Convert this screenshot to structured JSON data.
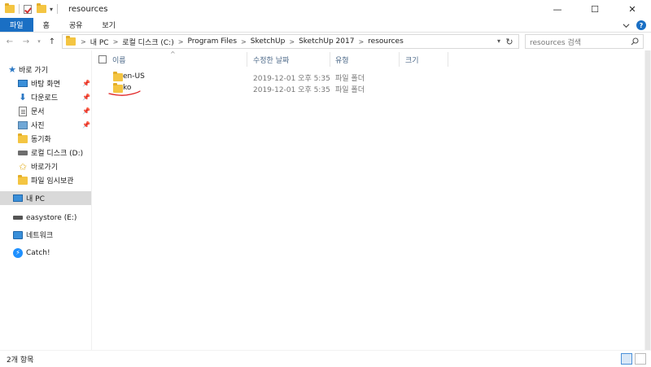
{
  "window": {
    "title": "resources",
    "controls": {
      "minimize": "—",
      "maximize": "☐",
      "close": "✕"
    }
  },
  "ribbon": {
    "tabs": [
      {
        "label": "파일",
        "active": true
      },
      {
        "label": "홈",
        "active": false
      },
      {
        "label": "공유",
        "active": false
      },
      {
        "label": "보기",
        "active": false
      }
    ],
    "accent_color": "#1a6fc4"
  },
  "address_bar": {
    "breadcrumbs": [
      "내 PC",
      "로컬 디스크 (C:)",
      "Program Files",
      "SketchUp",
      "SketchUp 2017",
      "resources"
    ],
    "separator": ">"
  },
  "search": {
    "placeholder": "resources 검색"
  },
  "sidebar": {
    "items": [
      {
        "label": "바로 가기",
        "icon": "star-icon",
        "pinned": false
      },
      {
        "label": "바탕 화면",
        "icon": "desktop-icon",
        "pinned": true
      },
      {
        "label": "다운로드",
        "icon": "download-icon",
        "pinned": true
      },
      {
        "label": "문서",
        "icon": "documents-icon",
        "pinned": true
      },
      {
        "label": "사진",
        "icon": "pictures-icon",
        "pinned": true
      },
      {
        "label": "동기화",
        "icon": "folder-icon",
        "pinned": false
      },
      {
        "label": "로컬 디스크 (D:)",
        "icon": "drive-icon",
        "pinned": false
      },
      {
        "label": "바로가기",
        "icon": "favorites-icon",
        "pinned": false
      },
      {
        "label": "파일 임시보관",
        "icon": "folder-icon",
        "pinned": false
      },
      {
        "label": "내 PC",
        "icon": "pc-icon",
        "pinned": false,
        "selected": true
      },
      {
        "label": "easystore (E:)",
        "icon": "usb-drive-icon",
        "pinned": false
      },
      {
        "label": "네트워크",
        "icon": "network-icon",
        "pinned": false
      },
      {
        "label": "Catch!",
        "icon": "catch-icon",
        "pinned": false
      }
    ]
  },
  "file_list": {
    "columns": [
      "이름",
      "수정한 날짜",
      "유형",
      "크기"
    ],
    "rows": [
      {
        "name": "en-US",
        "date": "2019-12-01 오후 5:35",
        "type": "파일 폴더",
        "size": ""
      },
      {
        "name": "ko",
        "date": "2019-12-01 오후 5:35",
        "type": "파일 폴더",
        "size": ""
      }
    ],
    "annotation_color": "#e02020"
  },
  "status_bar": {
    "item_count": "2개 항목"
  }
}
